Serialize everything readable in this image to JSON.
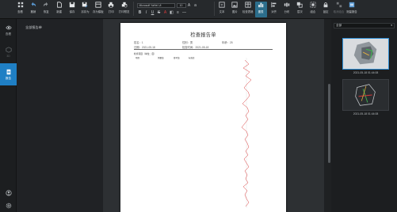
{
  "toolbar": {
    "buttons_left": [
      {
        "name": "list-button",
        "label": "查看",
        "icon": "grid-icon"
      },
      {
        "name": "undo-button",
        "label": "撤销",
        "icon": "undo-icon"
      },
      {
        "name": "redo-button",
        "label": "恢复",
        "icon": "redo-icon"
      },
      {
        "name": "new-button",
        "label": "新建",
        "icon": "new-doc-icon"
      },
      {
        "name": "save-button",
        "label": "保存",
        "icon": "save-icon"
      },
      {
        "name": "save-as-button",
        "label": "另存为",
        "icon": "save-as-icon"
      },
      {
        "name": "save-template-button",
        "label": "存为模板",
        "icon": "template-icon"
      },
      {
        "name": "print-button",
        "label": "打印",
        "icon": "print-icon"
      },
      {
        "name": "print-preview-button",
        "label": "打印预览",
        "icon": "print-preview-icon"
      }
    ],
    "font_name": "Microsoft YaHei UI",
    "font_size": "10",
    "buttons_right": [
      {
        "name": "text-button",
        "label": "文本",
        "icon": "text-icon",
        "state": "normal"
      },
      {
        "name": "image-button",
        "label": "图片",
        "icon": "image-icon",
        "state": "normal"
      },
      {
        "name": "insert-table-button",
        "label": "检查表格",
        "icon": "table-icon",
        "state": "normal"
      },
      {
        "name": "chart-button",
        "label": "图表",
        "icon": "chart-icon",
        "state": "active"
      },
      {
        "name": "align-button",
        "label": "对齐",
        "icon": "align-icon",
        "state": "normal"
      },
      {
        "name": "distribute-button",
        "label": "分布",
        "icon": "distribute-icon",
        "state": "normal"
      },
      {
        "name": "layer-button",
        "label": "层次",
        "icon": "layer-icon",
        "state": "normal"
      },
      {
        "name": "group-button",
        "label": "组合",
        "icon": "group-icon",
        "state": "normal"
      },
      {
        "name": "lock-button",
        "label": "锁定",
        "icon": "lock-icon",
        "state": "normal"
      },
      {
        "name": "ungroup-button",
        "label": "取消组合",
        "icon": "ungroup-icon",
        "state": "disabled"
      },
      {
        "name": "report-button",
        "label": "测量报告",
        "icon": "report-icon",
        "state": "normal"
      }
    ]
  },
  "leftnav": {
    "items": [
      {
        "name": "nav-item-view",
        "label": "查看",
        "icon": "eye-icon",
        "active": false
      },
      {
        "name": "nav-item-3d",
        "label": "3D",
        "icon": "cube-icon",
        "active": false
      },
      {
        "name": "nav-item-report",
        "label": "报告",
        "icon": "document-icon",
        "active": true
      }
    ],
    "bottom_icons": [
      "user-icon",
      "settings-icon"
    ]
  },
  "listpanel": {
    "title": "全部报告单"
  },
  "report": {
    "title": "检查报告单",
    "name_label": "姓名：",
    "name_value": "1",
    "gender_label": "性别：",
    "gender_value": "男",
    "age_label": "年龄：",
    "age_value": "25",
    "date_label": "日期：",
    "date_value": "2021-05-18",
    "check_date_label": "检查时间：",
    "check_date_value": "2021-05-18",
    "table_title": "检查项目（单位：度）",
    "columns": [
      "项目",
      "测量值",
      "参考值",
      "标准差"
    ]
  },
  "rightpanel": {
    "filter": "全部",
    "thumbnails": [
      {
        "time": "2021-05-18 01:44:08",
        "selected": true
      },
      {
        "time": "2021-05-18 01:44:08",
        "selected": false
      }
    ]
  },
  "colors": {
    "accent": "#1f7fc4",
    "background": "#1f2123",
    "page": "#ffffff",
    "graph_line": "#d83a3a"
  }
}
